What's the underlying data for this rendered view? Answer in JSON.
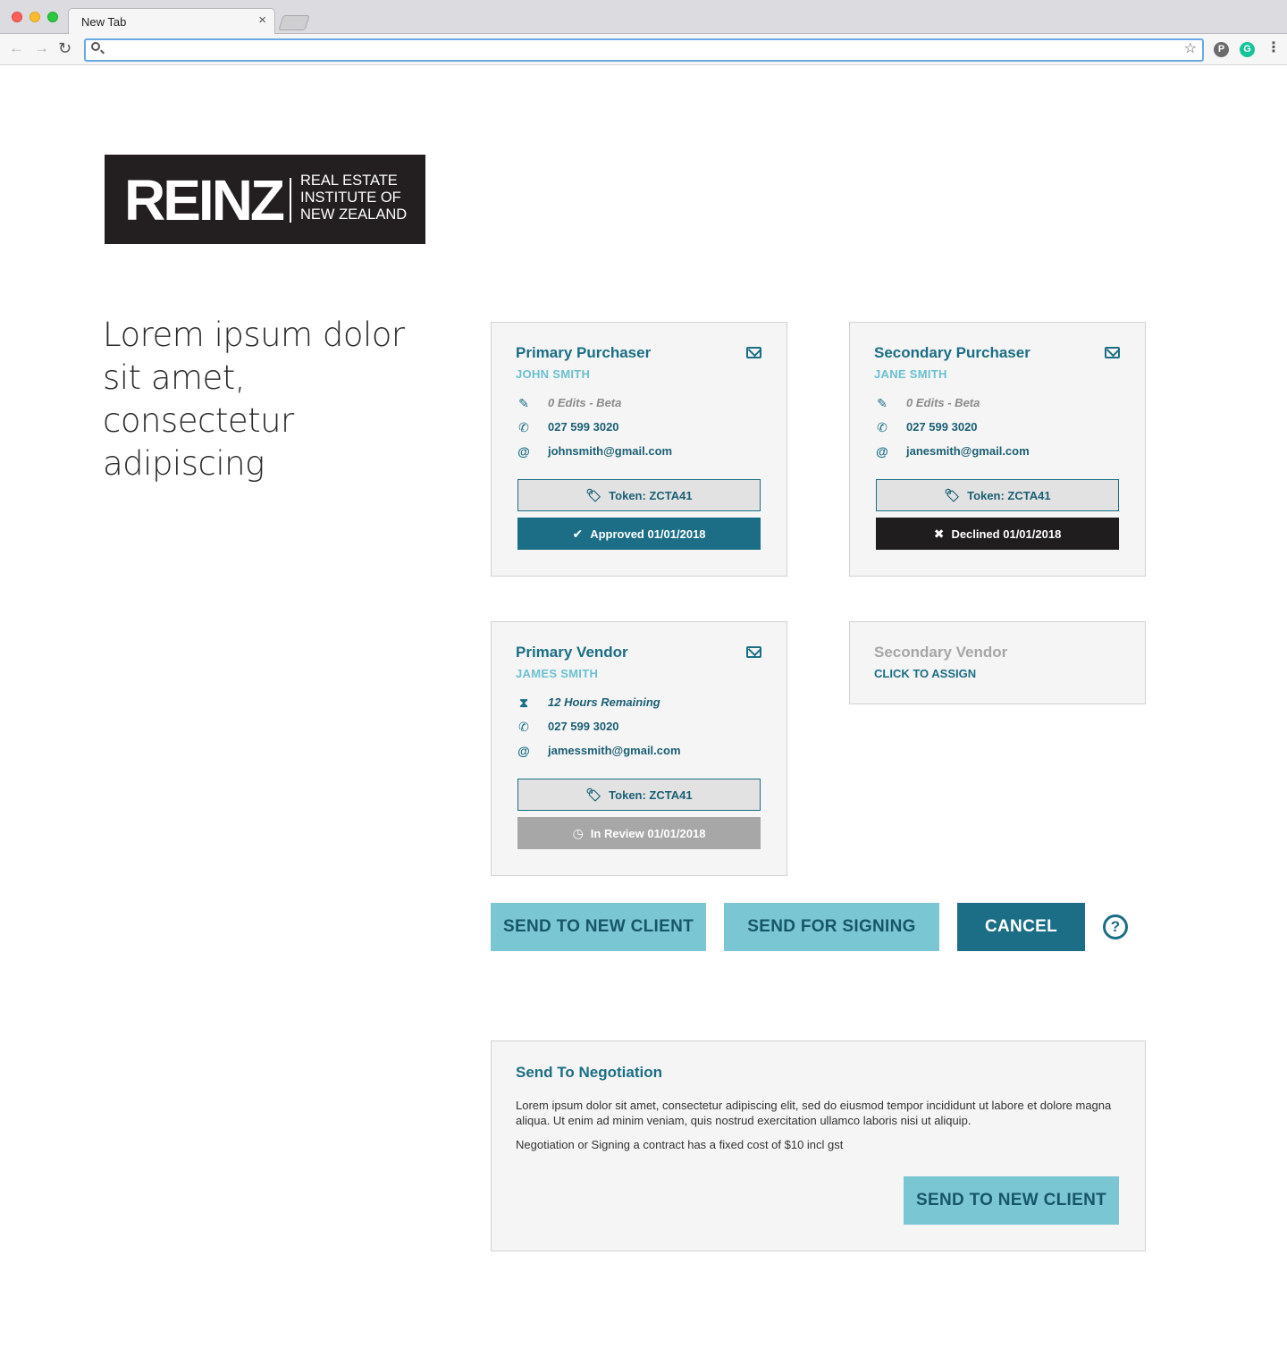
{
  "browser": {
    "tab_title": "New Tab",
    "tab_close": "×",
    "address_value": "",
    "back": "←",
    "forward": "→",
    "reload": "↻",
    "star": "☆",
    "menu": "⋮",
    "ext_pinterest": "P",
    "ext_grammarly": "G"
  },
  "logo": {
    "mark": "REINZ",
    "lines": [
      "REAL ESTATE",
      "INSTITUTE OF",
      "NEW ZEALAND"
    ]
  },
  "headline": "Lorem ipsum dolor sit amet, consectetur adipiscing",
  "cards": {
    "primary_purchaser": {
      "title": "Primary Purchaser",
      "name": "JOHN SMITH",
      "status_line": "0 Edits - Beta",
      "phone": "027 599 3020",
      "email": "johnsmith@gmail.com",
      "token": "Token: ZCTA41",
      "status": "Approved 01/01/2018"
    },
    "secondary_purchaser": {
      "title": "Secondary Purchaser",
      "name": "JANE SMITH",
      "status_line": "0 Edits - Beta",
      "phone": "027 599 3020",
      "email": "janesmith@gmail.com",
      "token": "Token: ZCTA41",
      "status": "Declined 01/01/2018"
    },
    "primary_vendor": {
      "title": "Primary Vendor",
      "name": "JAMES SMITH",
      "status_line": "12 Hours Remaining",
      "phone": "027 599 3020",
      "email": "jamessmith@gmail.com",
      "token": "Token: ZCTA41",
      "status": "In Review 01/01/2018"
    },
    "secondary_vendor": {
      "title": "Secondary Vendor",
      "link": "CLICK TO ASSIGN"
    }
  },
  "icons": {
    "edit": "✎",
    "phone": "✆",
    "at": "@",
    "hourglass": "⧗",
    "tag": "🏷",
    "approved": "✔",
    "declined": "✖",
    "review": "◷",
    "help": "?"
  },
  "actions": {
    "send_new_client": "SEND TO NEW CLIENT",
    "send_signing": "SEND FOR SIGNING",
    "cancel": "CANCEL"
  },
  "negotiation": {
    "title": "Send To Negotiation",
    "paragraph": "Lorem ipsum dolor sit amet, consectetur adipiscing elit, sed do eiusmod tempor incididunt ut labore et dolore magna aliqua. Ut enim ad minim veniam, quis nostrud exercitation ullamco laboris nisi ut aliquip.",
    "cost_note": "Negotiation or Signing a contract has a fixed cost of $10 incl gst",
    "button": "SEND TO NEW CLIENT"
  },
  "colors": {
    "brand_teal": "#1b6e85",
    "light_teal": "#7bc6d3",
    "declined_black": "#1f1d1e",
    "review_grey": "#a7a7a7"
  }
}
